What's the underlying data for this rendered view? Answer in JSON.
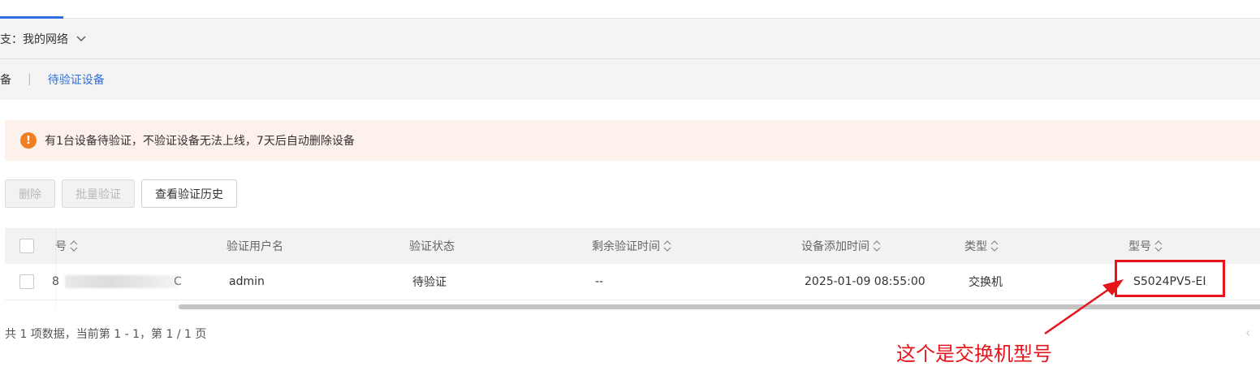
{
  "branch": {
    "label": "支：",
    "value": "我的网络"
  },
  "subtabs": {
    "all_devices": "备",
    "separator": "|",
    "pending": "待验证设备"
  },
  "alert": {
    "icon_text": "!",
    "message": "有1台设备待验证，不验证设备无法上线，7天后自动删除设备"
  },
  "toolbar": {
    "delete_label": "删除",
    "batch_verify_label": "批量验证",
    "history_label": "查看验证历史"
  },
  "table": {
    "columns": {
      "serial": "号",
      "username": "验证用户名",
      "status": "验证状态",
      "remaining": "剩余验证时间",
      "added_time": "设备添加时间",
      "type": "类型",
      "model": "型号"
    },
    "rows": [
      {
        "serial_prefix": "8",
        "serial_suffix": "C",
        "username": "admin",
        "status": "待验证",
        "remaining": "--",
        "added_time": "2025-01-09 08:55:00",
        "type": "交换机",
        "model": "S5024PV5-EI"
      }
    ]
  },
  "pagination": {
    "summary": "共 1 项数据，当前第 1 - 1，第 1 / 1 页",
    "prev_symbol": "‹"
  },
  "annotation": {
    "text": "这个是交换机型号",
    "color": "#e8141b"
  },
  "colors": {
    "accent": "#2f6fe4",
    "alert_bg": "#fdf1eb",
    "alert_icon": "#f07f23"
  }
}
